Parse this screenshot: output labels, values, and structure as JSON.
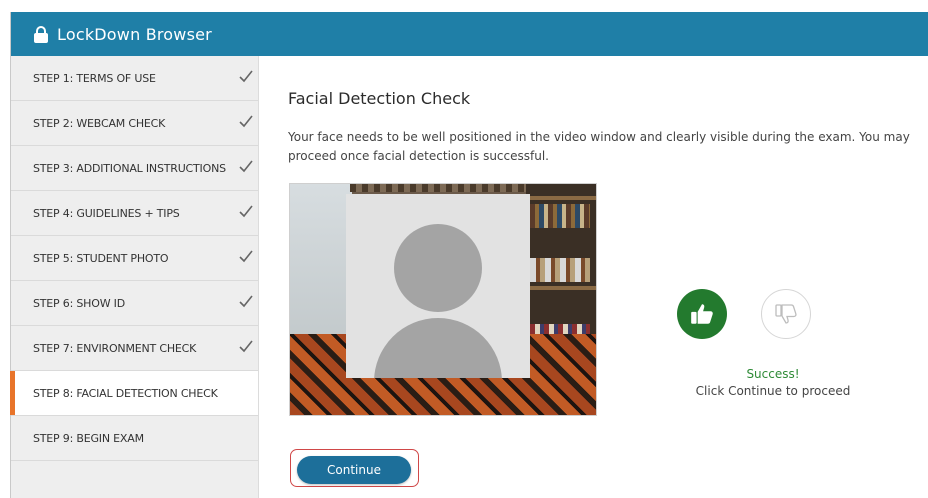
{
  "window": {
    "title": "LockDown Browser"
  },
  "sidebar": {
    "steps": [
      {
        "label": "STEP 1: TERMS OF USE",
        "completed": true
      },
      {
        "label": "STEP 2: WEBCAM CHECK",
        "completed": true
      },
      {
        "label": "STEP 3: ADDITIONAL INSTRUCTIONS",
        "completed": true
      },
      {
        "label": "STEP 4: GUIDELINES + TIPS",
        "completed": true
      },
      {
        "label": "STEP 5: STUDENT PHOTO",
        "completed": true
      },
      {
        "label": "STEP 6: SHOW ID",
        "completed": true
      },
      {
        "label": "STEP 7: ENVIRONMENT CHECK",
        "completed": true
      },
      {
        "label": "STEP 8: FACIAL DETECTION CHECK",
        "completed": false,
        "active": true
      },
      {
        "label": "STEP 9: BEGIN EXAM",
        "completed": false
      }
    ]
  },
  "main": {
    "heading": "Facial Detection Check",
    "description": "Your face needs to be well positioned in the video window and clearly visible during the exam. You may proceed once facial detection is successful.",
    "status_title": "Success!",
    "status_hint": "Click Continue to proceed",
    "continue_label": "Continue"
  },
  "colors": {
    "titlebar": "#1f7fa7",
    "active_step_accent": "#e8742a",
    "success_green": "#237a2e",
    "continue_button": "#1d6f9a",
    "highlight_ring": "#d04848"
  },
  "icons": {
    "lock": "lock-icon",
    "check": "checkmark-icon",
    "thumb_up": "thumbs-up-icon",
    "thumb_down": "thumbs-down-icon"
  }
}
